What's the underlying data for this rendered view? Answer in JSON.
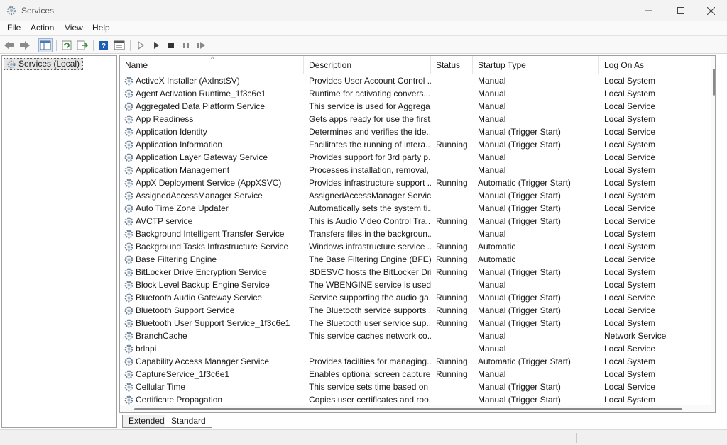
{
  "window": {
    "title": "Services",
    "icon": "services-gear-icon"
  },
  "menu": [
    "File",
    "Action",
    "View",
    "Help"
  ],
  "toolbar": {
    "buttons": [
      "back-icon",
      "forward-icon",
      "show-hide-console-tree-icon",
      "refresh-icon",
      "export-list-icon",
      "help-icon",
      "properties-icon",
      "start-service-icon",
      "start-service-2-icon",
      "stop-service-icon",
      "pause-service-icon",
      "restart-service-icon"
    ]
  },
  "tree": {
    "root_label": "Services (Local)"
  },
  "list": {
    "columns": [
      "Name",
      "Description",
      "Status",
      "Startup Type",
      "Log On As"
    ],
    "rows": [
      {
        "name": "ActiveX Installer (AxInstSV)",
        "desc": "Provides User Account Control ...",
        "status": "",
        "startup": "Manual",
        "logon": "Local System"
      },
      {
        "name": "Agent Activation Runtime_1f3c6e1",
        "desc": "Runtime for activating convers...",
        "status": "",
        "startup": "Manual",
        "logon": "Local System"
      },
      {
        "name": "Aggregated Data Platform Service",
        "desc": "This service is used for Aggrega...",
        "status": "",
        "startup": "Manual",
        "logon": "Local Service"
      },
      {
        "name": "App Readiness",
        "desc": "Gets apps ready for use the first...",
        "status": "",
        "startup": "Manual",
        "logon": "Local System"
      },
      {
        "name": "Application Identity",
        "desc": "Determines and verifies the ide...",
        "status": "",
        "startup": "Manual (Trigger Start)",
        "logon": "Local Service"
      },
      {
        "name": "Application Information",
        "desc": "Facilitates the running of intera...",
        "status": "Running",
        "startup": "Manual (Trigger Start)",
        "logon": "Local System"
      },
      {
        "name": "Application Layer Gateway Service",
        "desc": "Provides support for 3rd party p...",
        "status": "",
        "startup": "Manual",
        "logon": "Local Service"
      },
      {
        "name": "Application Management",
        "desc": "Processes installation, removal, ...",
        "status": "",
        "startup": "Manual",
        "logon": "Local System"
      },
      {
        "name": "AppX Deployment Service (AppXSVC)",
        "desc": "Provides infrastructure support ...",
        "status": "Running",
        "startup": "Automatic (Trigger Start)",
        "logon": "Local System"
      },
      {
        "name": "AssignedAccessManager Service",
        "desc": "AssignedAccessManager Servic...",
        "status": "",
        "startup": "Manual (Trigger Start)",
        "logon": "Local System"
      },
      {
        "name": "Auto Time Zone Updater",
        "desc": "Automatically sets the system ti...",
        "status": "",
        "startup": "Manual (Trigger Start)",
        "logon": "Local Service"
      },
      {
        "name": "AVCTP service",
        "desc": "This is Audio Video Control Tra...",
        "status": "Running",
        "startup": "Manual (Trigger Start)",
        "logon": "Local Service"
      },
      {
        "name": "Background Intelligent Transfer Service",
        "desc": "Transfers files in the backgroun...",
        "status": "",
        "startup": "Manual",
        "logon": "Local System"
      },
      {
        "name": "Background Tasks Infrastructure Service",
        "desc": "Windows infrastructure service ...",
        "status": "Running",
        "startup": "Automatic",
        "logon": "Local System"
      },
      {
        "name": "Base Filtering Engine",
        "desc": "The Base Filtering Engine (BFE) ...",
        "status": "Running",
        "startup": "Automatic",
        "logon": "Local Service"
      },
      {
        "name": "BitLocker Drive Encryption Service",
        "desc": "BDESVC hosts the BitLocker Dri...",
        "status": "Running",
        "startup": "Manual (Trigger Start)",
        "logon": "Local System"
      },
      {
        "name": "Block Level Backup Engine Service",
        "desc": "The WBENGINE service is used ...",
        "status": "",
        "startup": "Manual",
        "logon": "Local System"
      },
      {
        "name": "Bluetooth Audio Gateway Service",
        "desc": "Service supporting the audio ga...",
        "status": "Running",
        "startup": "Manual (Trigger Start)",
        "logon": "Local Service"
      },
      {
        "name": "Bluetooth Support Service",
        "desc": "The Bluetooth service supports ...",
        "status": "Running",
        "startup": "Manual (Trigger Start)",
        "logon": "Local Service"
      },
      {
        "name": "Bluetooth User Support Service_1f3c6e1",
        "desc": "The Bluetooth user service sup...",
        "status": "Running",
        "startup": "Manual (Trigger Start)",
        "logon": "Local System"
      },
      {
        "name": "BranchCache",
        "desc": "This service caches network co...",
        "status": "",
        "startup": "Manual",
        "logon": "Network Service"
      },
      {
        "name": "brlapi",
        "desc": "",
        "status": "",
        "startup": "Manual",
        "logon": "Local Service"
      },
      {
        "name": "Capability Access Manager Service",
        "desc": "Provides facilities for managing...",
        "status": "Running",
        "startup": "Automatic (Trigger Start)",
        "logon": "Local System"
      },
      {
        "name": "CaptureService_1f3c6e1",
        "desc": "Enables optional screen capture...",
        "status": "Running",
        "startup": "Manual",
        "logon": "Local System"
      },
      {
        "name": "Cellular Time",
        "desc": "This service sets time based on ...",
        "status": "",
        "startup": "Manual (Trigger Start)",
        "logon": "Local Service"
      },
      {
        "name": "Certificate Propagation",
        "desc": "Copies user certificates and roo...",
        "status": "",
        "startup": "Manual (Trigger Start)",
        "logon": "Local System"
      }
    ]
  },
  "tabs": [
    "Extended",
    "Standard"
  ],
  "colors": {
    "selection": "#e5e5e5",
    "border": "#a0a0a0",
    "toolbar_blue": "#1f5fb0",
    "refresh_green": "#2e8b3a"
  }
}
